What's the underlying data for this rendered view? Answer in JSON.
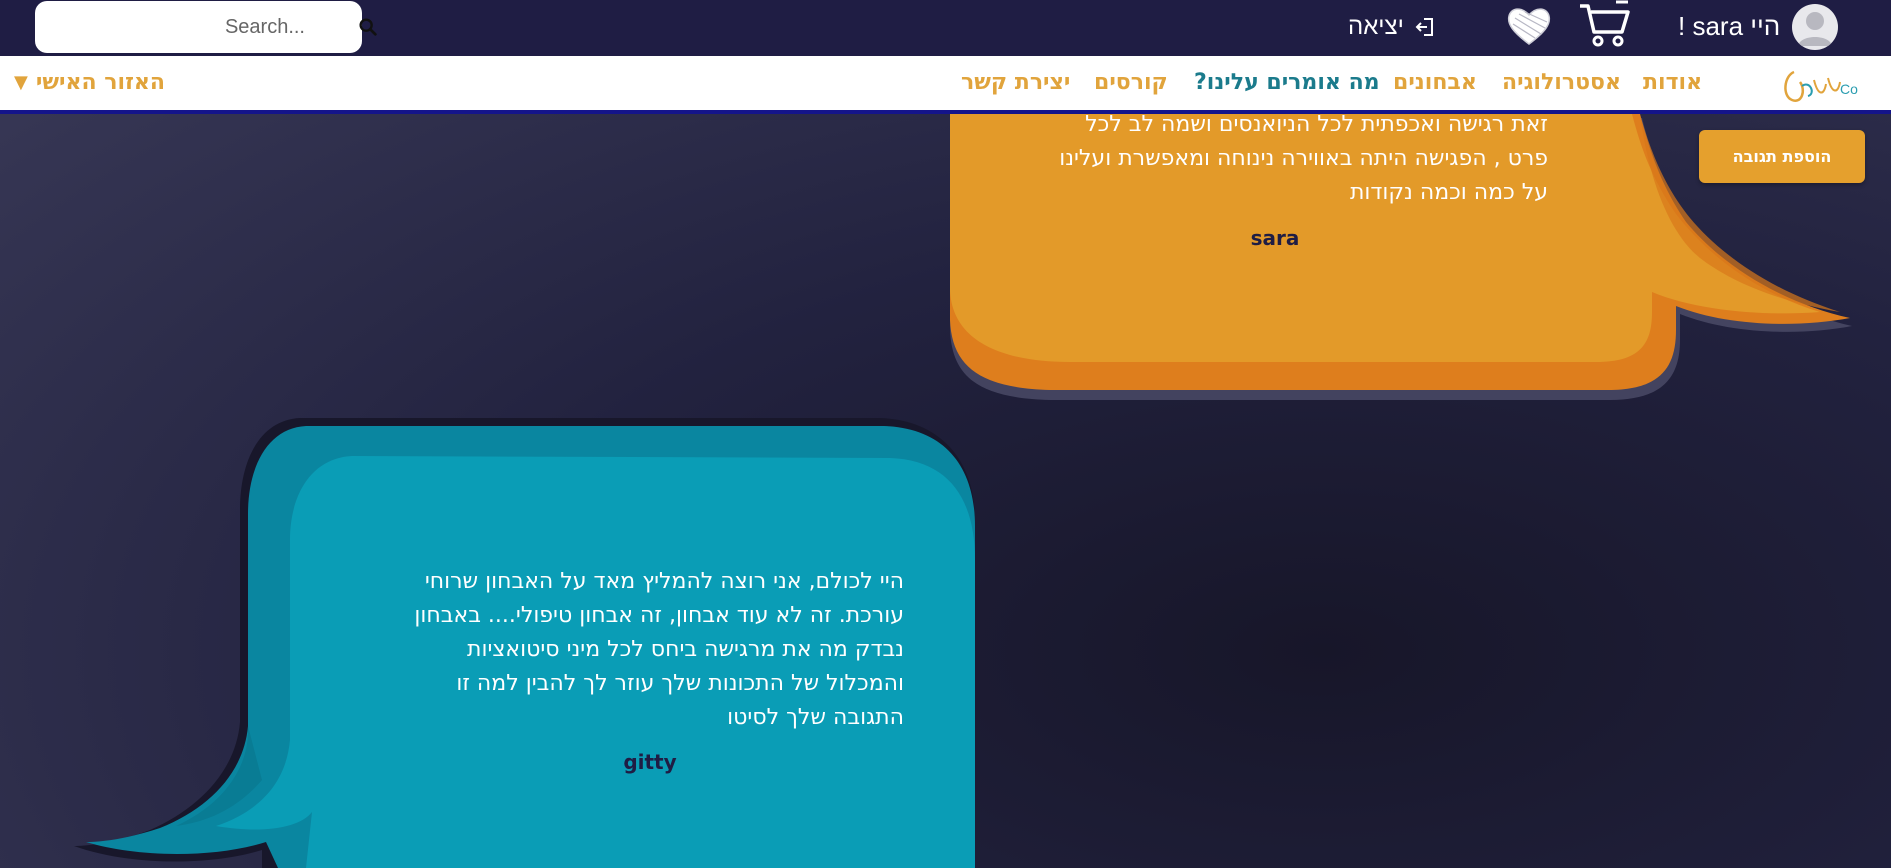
{
  "topbar": {
    "search_placeholder": "Search...",
    "logout_label": "יציאה",
    "greeting": "היי sara !"
  },
  "nav": {
    "items": [
      "אודות",
      "אסטרולוגיה",
      "אבחונים",
      "מה אומרים עלינו?",
      "קורסים",
      "יצירת קשר"
    ],
    "active_index": 3,
    "personal_area": "האזור האישי",
    "logo_text": "Coאירפוות"
  },
  "add_button_label": "הוספת תגובה",
  "testimonials": [
    {
      "lines": [
        "זאת רגישה ואכפתית לכל הניואנסים ושמה לב לכל",
        "פרט , הפגישה היתה באווירה נינוחה ומאפשרת ועלינו",
        "על כמה וכמה נקודות"
      ],
      "author": "sara",
      "color": "#e39a29"
    },
    {
      "lines": [
        "היי לכולם, אני רוצה להמליץ מאד על האבחון שרוחי",
        "עורכת. זה לא עוד אבחון, זה אבחון טיפולי.... באבחון",
        "נבדק מה את מרגישה ביחס לכל מיני סיטואציות",
        "והמכלול של התכונות שלך עוזר לך להבין למה זו",
        "התגובה שלך לסיטו"
      ],
      "author": "gitty",
      "color": "#0a9db6"
    }
  ],
  "colors": {
    "topbar_bg": "#1f1d44",
    "nav_accent": "#e1a43c",
    "nav_active": "#1b7b8c",
    "orange_bubble": "#e39a29",
    "teal_bubble": "#0a9db6"
  },
  "icons": [
    "search-icon",
    "logout-icon",
    "heart-icon",
    "cart-icon",
    "avatar-icon"
  ]
}
